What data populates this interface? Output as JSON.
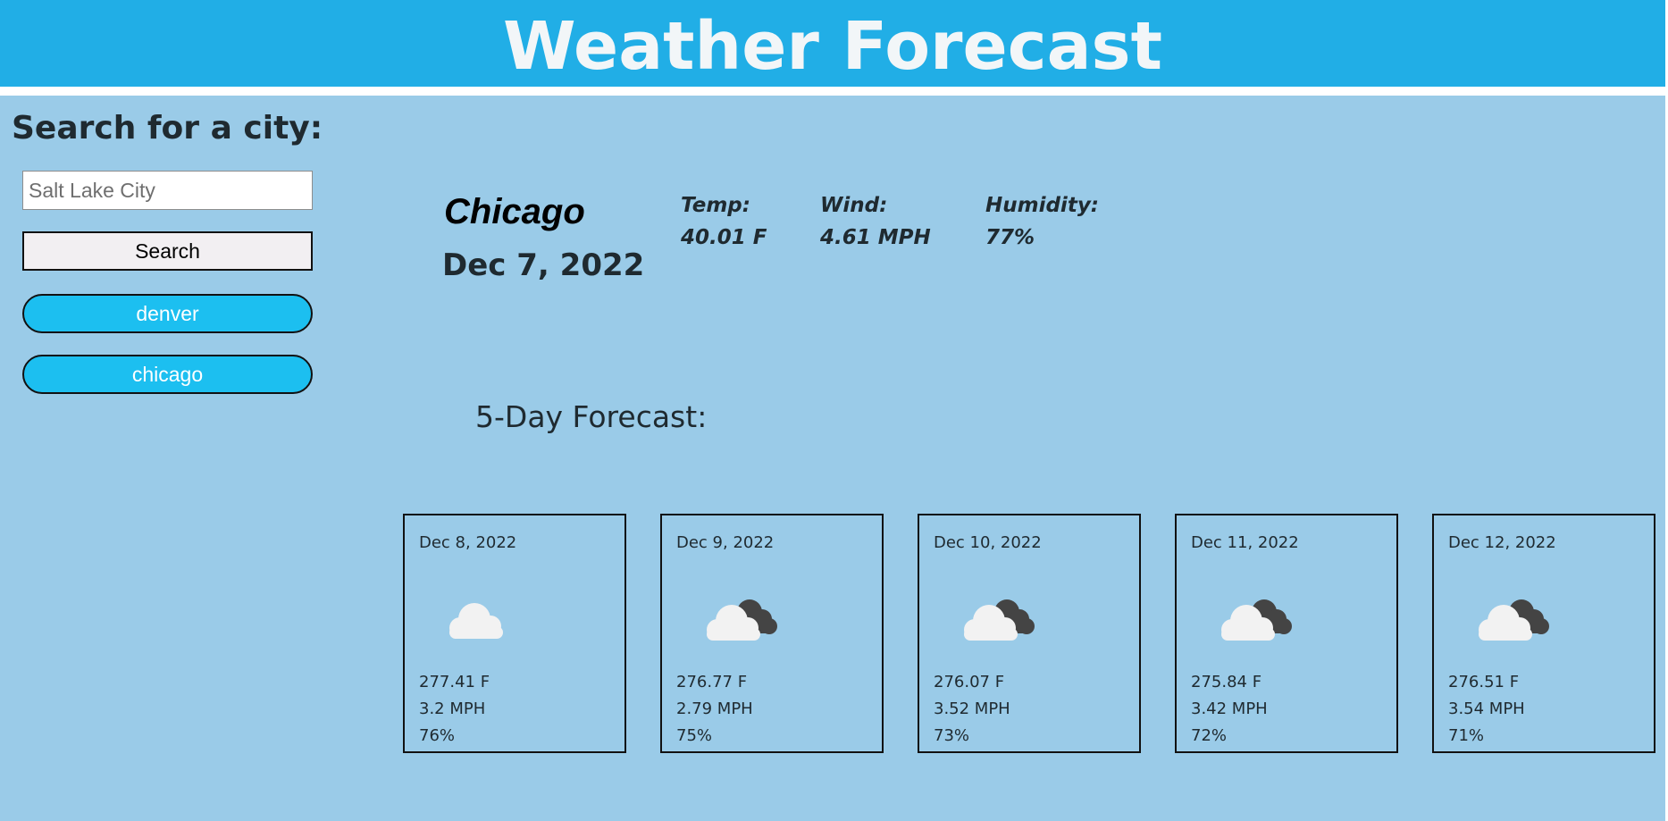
{
  "header": {
    "title": "Weather Forecast"
  },
  "search": {
    "heading": "Search for a city:",
    "placeholder": "Salt Lake City",
    "button_label": "Search",
    "history": [
      "denver",
      "chicago"
    ]
  },
  "current": {
    "city": "Chicago",
    "date": "Dec 7, 2022",
    "temp_label": "Temp:",
    "temp_value": "40.01 F",
    "wind_label": "Wind:",
    "wind_value": "4.61 MPH",
    "humidity_label": "Humidity:",
    "humidity_value": "77%"
  },
  "forecast": {
    "heading": "5-Day Forecast:",
    "days": [
      {
        "date": "Dec 8, 2022",
        "icon": "cloud-icon",
        "temp": "277.41 F",
        "wind": "3.2 MPH",
        "humidity": "76%"
      },
      {
        "date": "Dec 9, 2022",
        "icon": "broken-clouds-icon",
        "temp": "276.77 F",
        "wind": "2.79 MPH",
        "humidity": "75%"
      },
      {
        "date": "Dec 10, 2022",
        "icon": "broken-clouds-icon",
        "temp": "276.07 F",
        "wind": "3.52 MPH",
        "humidity": "73%"
      },
      {
        "date": "Dec 11, 2022",
        "icon": "broken-clouds-icon",
        "temp": "275.84 F",
        "wind": "3.42 MPH",
        "humidity": "72%"
      },
      {
        "date": "Dec 12, 2022",
        "icon": "broken-clouds-icon",
        "temp": "276.51 F",
        "wind": "3.54 MPH",
        "humidity": "71%"
      }
    ]
  },
  "colors": {
    "banner": "#21aee6",
    "background": "#9acbe8",
    "history_button": "#1cbff0"
  }
}
